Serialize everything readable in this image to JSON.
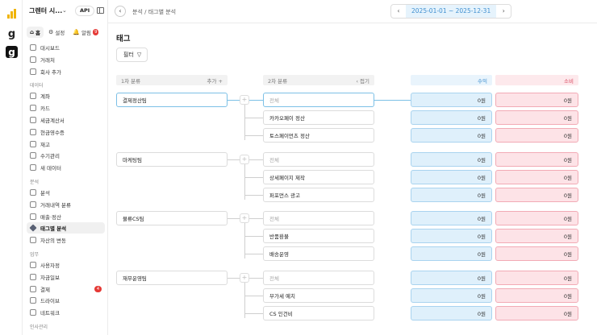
{
  "sidebar": {
    "workspace": "그렌터 시...",
    "api_label": "API",
    "top_tabs": [
      {
        "icon": "home-icon",
        "label": "홈"
      },
      {
        "icon": "gear-icon",
        "label": "설정"
      },
      {
        "icon": "bell-icon",
        "label": "알림",
        "badge": "9"
      }
    ],
    "items_top": [
      {
        "icon": "dashboard-icon",
        "label": "대시보드"
      },
      {
        "icon": "clients-icon",
        "label": "거래처"
      },
      {
        "icon": "plus-icon",
        "label": "회사 추가"
      }
    ],
    "sections": [
      {
        "title": "데이터",
        "items": [
          {
            "icon": "account-icon",
            "label": "계좌"
          },
          {
            "icon": "card-icon",
            "label": "카드"
          },
          {
            "icon": "invoice-icon",
            "label": "세금계산서"
          },
          {
            "icon": "receipt-icon",
            "label": "현금영수증"
          },
          {
            "icon": "box-icon",
            "label": "재고"
          },
          {
            "icon": "manual-icon",
            "label": "수기관리"
          },
          {
            "icon": "new-data-icon",
            "label": "새 데이터"
          }
        ]
      },
      {
        "title": "분석",
        "items": [
          {
            "icon": "analysis-icon",
            "label": "분석"
          },
          {
            "icon": "transaction-icon",
            "label": "거래내역 분류"
          },
          {
            "icon": "settlement-icon",
            "label": "매출·정산"
          },
          {
            "icon": "tag-icon",
            "label": "태그별 분석",
            "active": true
          },
          {
            "icon": "asset-icon",
            "label": "자산의 변동"
          }
        ]
      },
      {
        "title": "업무",
        "items": [
          {
            "icon": "send-icon",
            "label": "사용자정"
          },
          {
            "icon": "report-icon",
            "label": "자금일보"
          },
          {
            "icon": "payment-icon",
            "label": "결제",
            "count": "4"
          },
          {
            "icon": "drive-icon",
            "label": "드라이브"
          },
          {
            "icon": "network-icon",
            "label": "네트워크"
          }
        ]
      },
      {
        "title": "인사관리",
        "items": []
      }
    ]
  },
  "topbar": {
    "breadcrumb": "분석 / 태그별 분석",
    "date_range": "2025-01-01 ~ 2025-12-31"
  },
  "main": {
    "title": "태그",
    "filter_label": "필터",
    "headers": {
      "cat1": "1차 분류",
      "cat1_action": "추가 +",
      "cat2": "2차 분류",
      "cat2_action": "‹ 접기",
      "income": "수익",
      "expense": "소비"
    },
    "groups": [
      {
        "name": "결제정산팀",
        "rows": [
          {
            "label": "전체",
            "placeholder": true,
            "income": "0원",
            "expense": "0원"
          },
          {
            "label": "카카오페이 정산",
            "income": "0원",
            "expense": "0원"
          },
          {
            "label": "토스페이먼츠 정산",
            "income": "0원",
            "expense": "0원"
          }
        ]
      },
      {
        "name": "마케팅팀",
        "rows": [
          {
            "label": "전체",
            "placeholder": true,
            "income": "0원",
            "expense": "0원"
          },
          {
            "label": "상세페이지 제작",
            "income": "0원",
            "expense": "0원"
          },
          {
            "label": "퍼포먼스 광고",
            "income": "0원",
            "expense": "0원"
          }
        ]
      },
      {
        "name": "물류CS팀",
        "rows": [
          {
            "label": "전체",
            "placeholder": true,
            "income": "0원",
            "expense": "0원"
          },
          {
            "label": "반품환불",
            "income": "0원",
            "expense": "0원"
          },
          {
            "label": "배송운영",
            "income": "0원",
            "expense": "0원"
          }
        ]
      },
      {
        "name": "재무운영팀",
        "rows": [
          {
            "label": "전체",
            "placeholder": true,
            "income": "0원",
            "expense": "0원"
          },
          {
            "label": "부가세 예치",
            "income": "0원",
            "expense": "0원"
          },
          {
            "label": "CS 인건비",
            "income": "0원",
            "expense": "0원"
          }
        ]
      }
    ]
  }
}
